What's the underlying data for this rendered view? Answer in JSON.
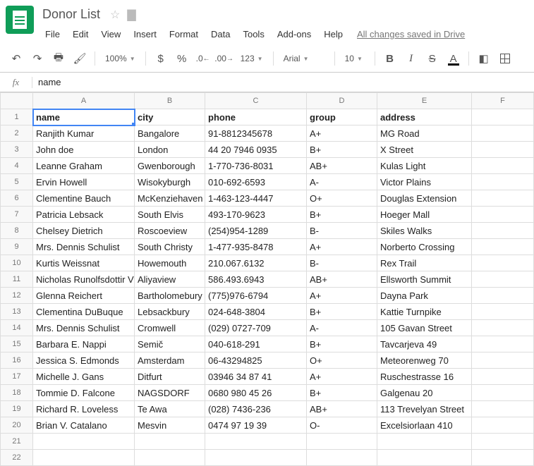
{
  "doc": {
    "title": "Donor List"
  },
  "menu": {
    "file": "File",
    "edit": "Edit",
    "view": "View",
    "insert": "Insert",
    "format": "Format",
    "data": "Data",
    "tools": "Tools",
    "addons": "Add-ons",
    "help": "Help",
    "save_status": "All changes saved in Drive"
  },
  "toolbar": {
    "zoom": "100%",
    "numfmt": "123",
    "font": "Arial",
    "size": "10",
    "currency": "$",
    "percent": "%"
  },
  "formula": {
    "value": "name"
  },
  "columns": [
    "A",
    "B",
    "C",
    "D",
    "E",
    "F"
  ],
  "headers": {
    "A": "name",
    "B": "city",
    "C": "phone",
    "D": "group",
    "E": "address"
  },
  "rows": [
    {
      "n": 2,
      "A": "Ranjith Kumar",
      "B": "Bangalore",
      "C": "91-8812345678",
      "D": "A+",
      "E": "MG Road"
    },
    {
      "n": 3,
      "A": "John doe",
      "B": "London",
      "C": "44 20 7946 0935",
      "D": "B+",
      "E": "X Street"
    },
    {
      "n": 4,
      "A": "Leanne Graham",
      "B": "Gwenborough",
      "C": "1-770-736-8031",
      "D": "AB+",
      "E": "Kulas Light"
    },
    {
      "n": 5,
      "A": "Ervin Howell",
      "B": "Wisokyburgh",
      "C": "010-692-6593",
      "D": "A-",
      "E": "Victor Plains"
    },
    {
      "n": 6,
      "A": "Clementine Bauch",
      "B": "McKenziehaven",
      "C": "1-463-123-4447",
      "D": "O+",
      "E": "Douglas Extension"
    },
    {
      "n": 7,
      "A": "Patricia Lebsack",
      "B": "South Elvis",
      "C": "493-170-9623",
      "D": "B+",
      "E": "Hoeger Mall"
    },
    {
      "n": 8,
      "A": "Chelsey Dietrich",
      "B": "Roscoeview",
      "C": "(254)954-1289",
      "D": "B-",
      "E": "Skiles Walks"
    },
    {
      "n": 9,
      "A": "Mrs. Dennis Schulist",
      "B": "South Christy",
      "C": "1-477-935-8478",
      "D": "A+",
      "E": "Norberto Crossing"
    },
    {
      "n": 10,
      "A": "Kurtis Weissnat",
      "B": "Howemouth",
      "C": "210.067.6132",
      "D": "B-",
      "E": "Rex Trail"
    },
    {
      "n": 11,
      "A": "Nicholas Runolfsdottir V",
      "B": "Aliyaview",
      "C": "586.493.6943",
      "D": "AB+",
      "E": "Ellsworth Summit"
    },
    {
      "n": 12,
      "A": "Glenna Reichert",
      "B": "Bartholomebury",
      "C": "(775)976-6794",
      "D": "A+",
      "E": "Dayna Park"
    },
    {
      "n": 13,
      "A": "Clementina DuBuque",
      "B": "Lebsackbury",
      "C": "024-648-3804",
      "D": "B+",
      "E": "Kattie Turnpike"
    },
    {
      "n": 14,
      "A": "Mrs. Dennis Schulist",
      "B": "Cromwell",
      "C": "(029) 0727-709",
      "D": "A-",
      "E": "105 Gavan Street"
    },
    {
      "n": 15,
      "A": "Barbara E. Nappi",
      "B": "Semič",
      "C": "040-618-291",
      "D": "B+",
      "E": "Tavcarjeva 49"
    },
    {
      "n": 16,
      "A": "Jessica S. Edmonds",
      "B": "Amsterdam",
      "C": "06-43294825",
      "D": "O+",
      "E": "Meteorenweg 70"
    },
    {
      "n": 17,
      "A": "Michelle J. Gans",
      "B": "Ditfurt",
      "C": "03946 34 87 41",
      "D": "A+",
      "E": "Ruschestrasse 16"
    },
    {
      "n": 18,
      "A": "Tommie D. Falcone",
      "B": "NAGSDORF",
      "C": "0680 980 45 26",
      "D": "B+",
      "E": "Galgenau 20"
    },
    {
      "n": 19,
      "A": "Richard R. Loveless",
      "B": "Te Awa",
      "C": "(028) 7436-236",
      "D": "AB+",
      "E": "113 Trevelyan Street"
    },
    {
      "n": 20,
      "A": "Brian V. Catalano",
      "B": "Mesvin",
      "C": "0474 97 19 39",
      "D": "O-",
      "E": "Excelsiorlaan 410"
    }
  ],
  "empty_rows": [
    21,
    22
  ]
}
